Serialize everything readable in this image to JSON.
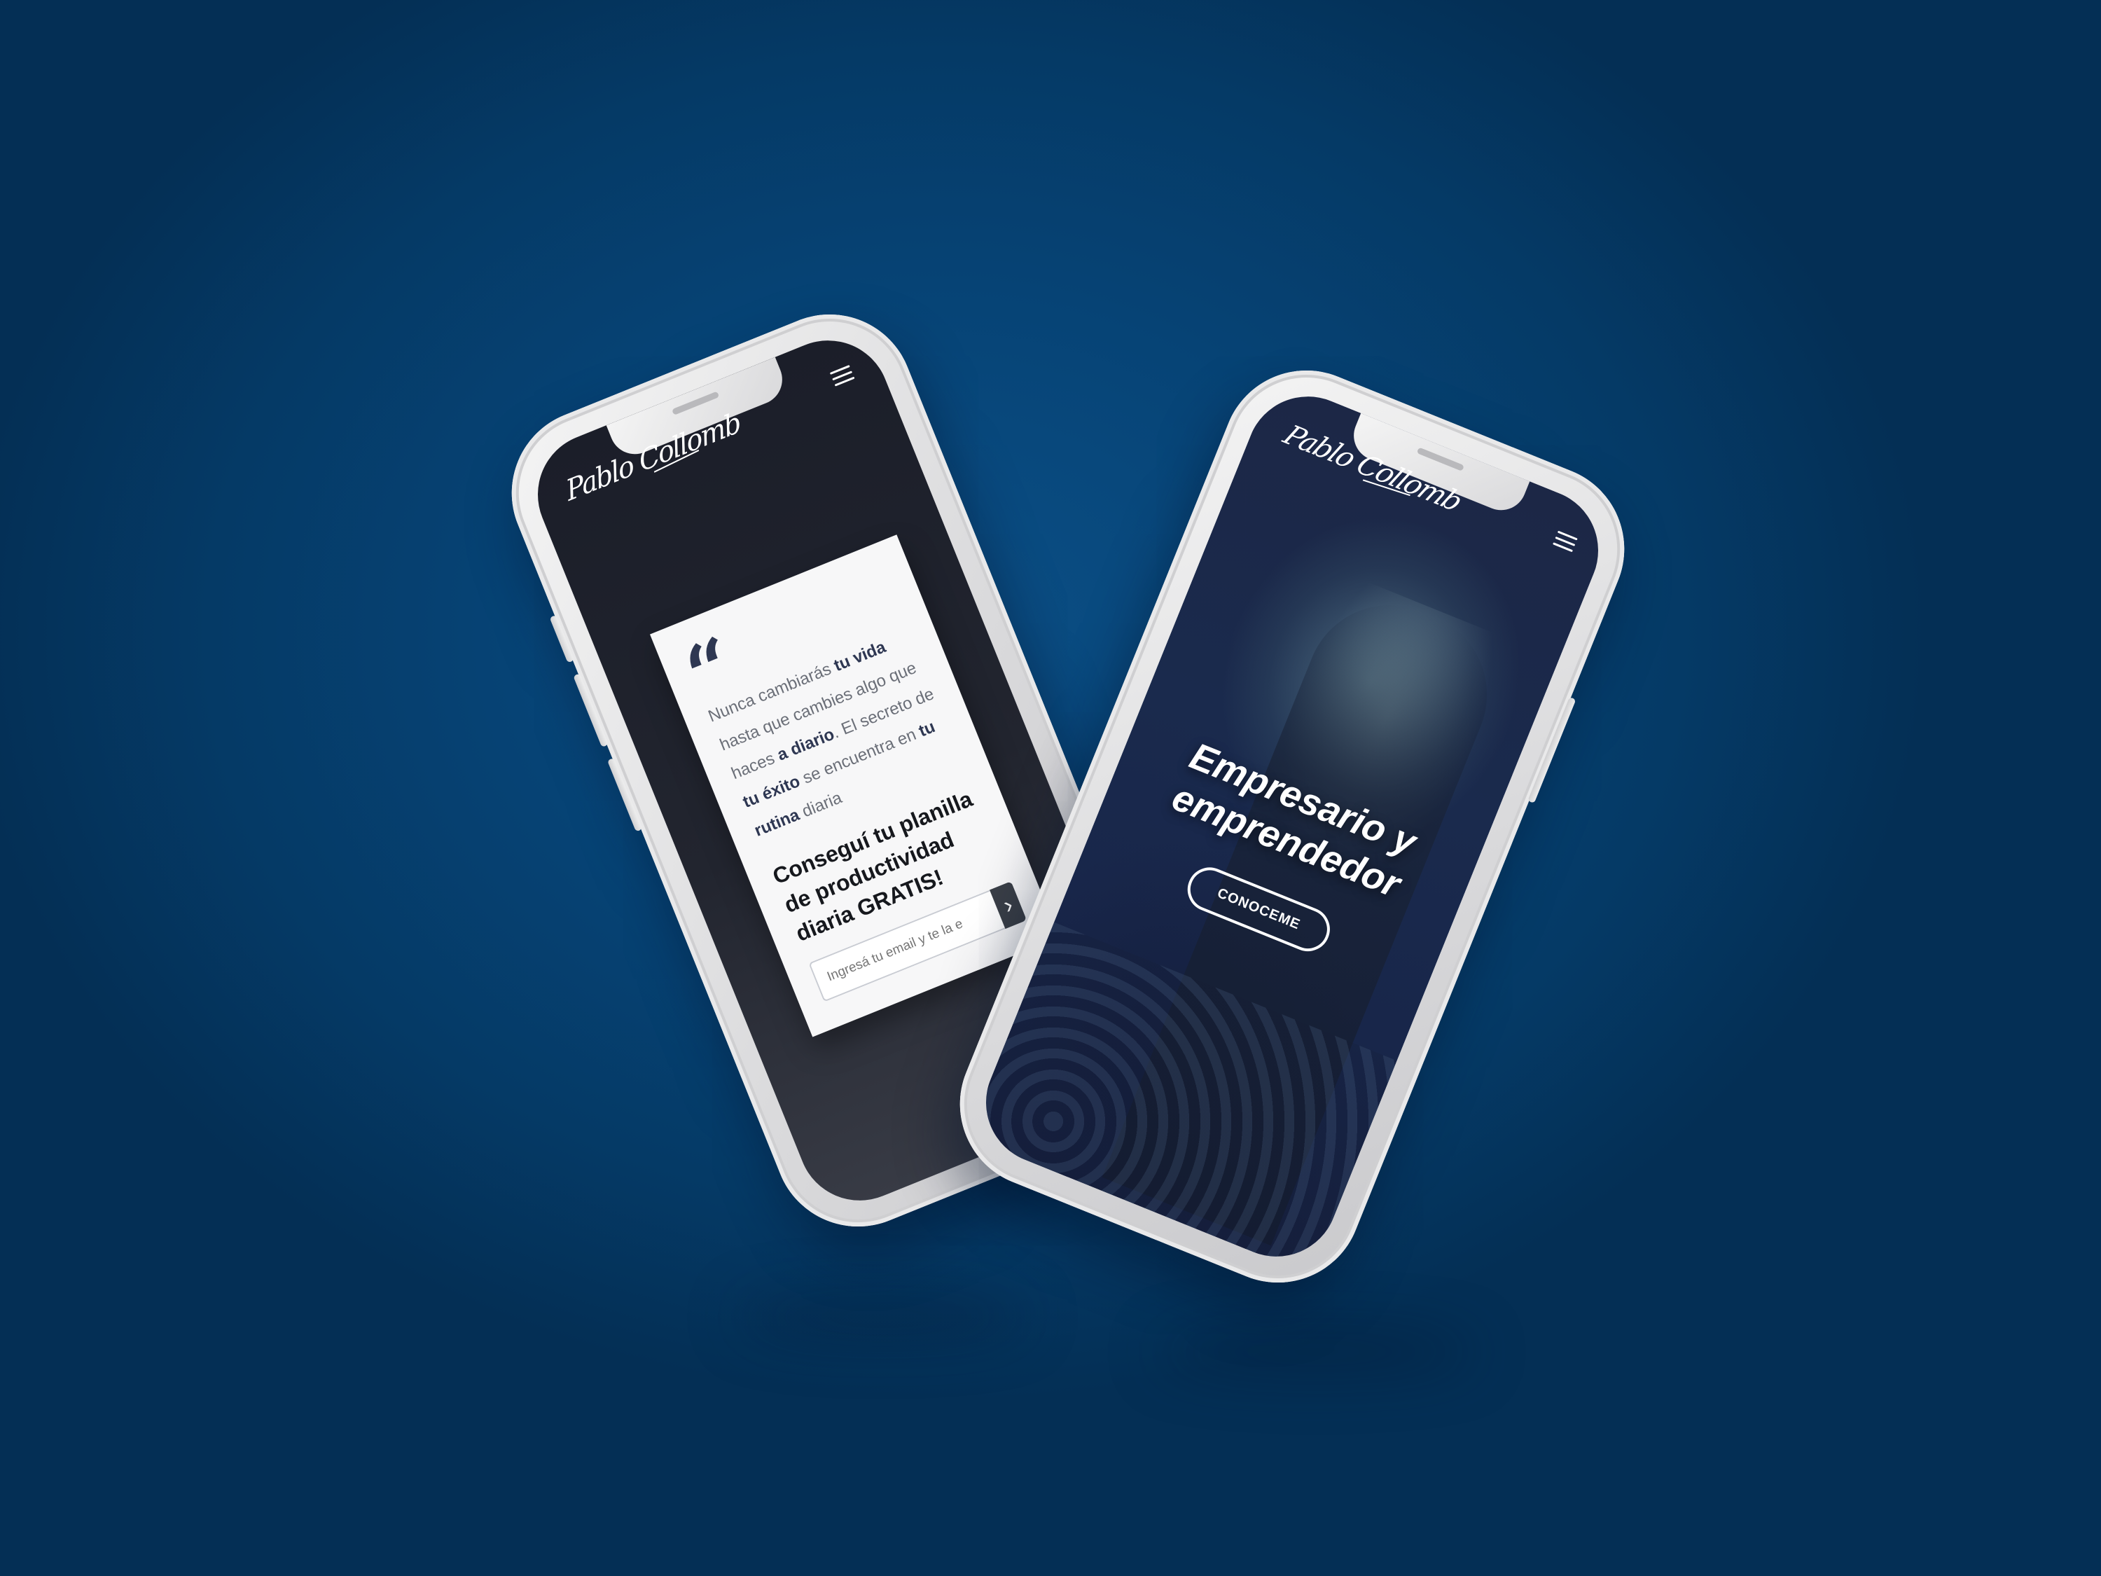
{
  "left_phone": {
    "logo": "Pablo Collomb",
    "quote_mark": "“",
    "quote": {
      "p1": "Nunca cambiarás ",
      "b1": "tu vida",
      "p2": " hasta que cambies algo que haces ",
      "b2": "a diario",
      "p3": ". El secreto de ",
      "b3": "tu éxito",
      "p4": " se encuentra en ",
      "b4": "tu rutina",
      "p5": " diaria"
    },
    "cta_text": "Conseguí tu planilla de productividad diaria GRATIS!",
    "email_placeholder": "Ingresá tu email y te la e",
    "submit_icon": "chevron-right-icon"
  },
  "right_phone": {
    "logo": "Pablo Collomb",
    "hero_title": "Empresario y emprendedor",
    "hero_button": "CONOCEME"
  },
  "colors": {
    "background": "#064375",
    "accent_navy": "#2e3752",
    "card": "#f7f7f8",
    "phone_body": "#dcdcde"
  }
}
